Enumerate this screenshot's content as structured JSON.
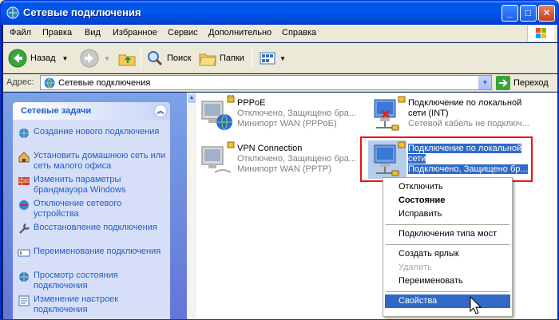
{
  "window": {
    "title": "Сетевые подключения"
  },
  "menu": [
    "Файл",
    "Правка",
    "Вид",
    "Избранное",
    "Сервис",
    "Дополнительно",
    "Справка"
  ],
  "toolbar": {
    "back_label": "Назад",
    "search_label": "Поиск",
    "folders_label": "Папки"
  },
  "address": {
    "label": "Адрес:",
    "value": "Сетевые подключения",
    "go_label": "Переход"
  },
  "taskpane": {
    "title": "Сетевые задачи",
    "tasks": [
      {
        "label": "Создание нового подключения",
        "icon": "new-connection-icon"
      },
      {
        "label": "Установить домашнюю сеть или сеть малого офиса",
        "icon": "home-network-icon"
      },
      {
        "label": "Изменить параметры брандмауэра Windows",
        "icon": "firewall-icon"
      },
      {
        "label": "Отключение сетевого устройства",
        "icon": "disable-device-icon"
      },
      {
        "label": "Восстановление подключения",
        "icon": "repair-icon"
      },
      {
        "label": "Переименование подключения",
        "icon": "rename-icon"
      },
      {
        "label": "Просмотр состояния подключения",
        "icon": "status-icon"
      },
      {
        "label": "Изменение настроек подключения",
        "icon": "settings-icon"
      }
    ]
  },
  "connections": [
    {
      "name": "PPPoE",
      "status": "Отключено, Защищено бра...",
      "device": "Минипорт WAN (PPPoE)"
    },
    {
      "name": "VPN Connection",
      "status": "Отключено, Защищено бра...",
      "device": "Минипорт WAN (PPTP)"
    },
    {
      "name": "Подключение по локальной сети (INT)",
      "name_line1": "Подключение по локальной",
      "name_line2": "сети (INT)",
      "status": "Сетевой кабель не подключ..."
    },
    {
      "name": "Подключение по локальной сети",
      "name_line1": "Подключение по локальной",
      "name_line2": "сети",
      "status": "Подключено, Защищено бр..."
    }
  ],
  "context_menu": {
    "items": [
      {
        "label": "Отключить",
        "style": "normal"
      },
      {
        "label": "Состояние",
        "style": "bold"
      },
      {
        "label": "Исправить",
        "style": "normal"
      },
      {
        "label": "Подключения типа мост",
        "style": "normal"
      },
      {
        "label": "Создать ярлык",
        "style": "normal"
      },
      {
        "label": "Удалить",
        "style": "disabled"
      },
      {
        "label": "Переименовать",
        "style": "normal"
      },
      {
        "label": "Свойства",
        "style": "highlighted"
      }
    ]
  },
  "colors": {
    "selection": "#316ac5",
    "highlight_box": "#e11111",
    "task_link": "#215dc6"
  }
}
